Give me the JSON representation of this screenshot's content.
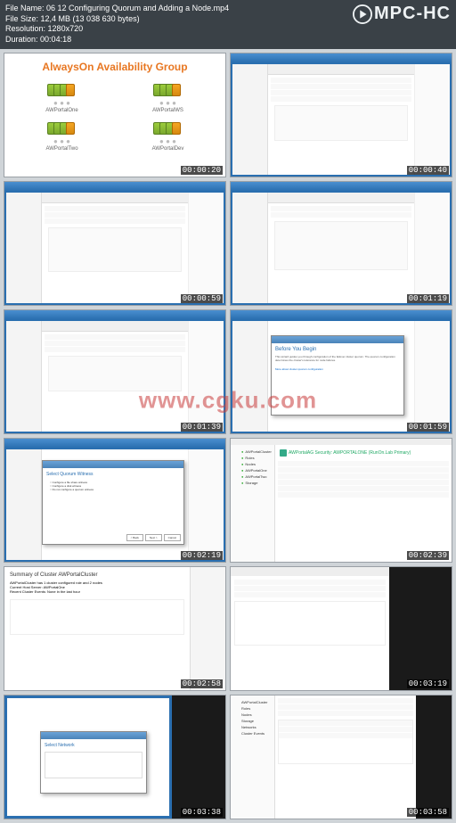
{
  "app": {
    "name": "MPC-HC"
  },
  "meta": {
    "filename_label": "File Name:",
    "filename": "06 12 Configuring Quorum and Adding a Node.mp4",
    "filesize_label": "File Size:",
    "filesize": "12,4 MB (13 038 630 bytes)",
    "resolution_label": "Resolution:",
    "resolution": "1280x720",
    "duration_label": "Duration:",
    "duration": "00:04:18"
  },
  "watermark": "www.cgku.com",
  "thumbs": [
    {
      "ts": "00:00:20",
      "kind": "diagram",
      "title": "AlwaysOn Availability Group",
      "nodes": [
        "AWPortalOne",
        "AWPortalWS",
        "AWPortalTwo",
        "AWPortalDev"
      ]
    },
    {
      "ts": "00:00:40",
      "kind": "mgr"
    },
    {
      "ts": "00:00:59",
      "kind": "mgr"
    },
    {
      "ts": "00:01:19",
      "kind": "mgr"
    },
    {
      "ts": "00:01:39",
      "kind": "mgr"
    },
    {
      "ts": "00:01:59",
      "kind": "wizard",
      "title": "Before You Begin"
    },
    {
      "ts": "00:02:19",
      "kind": "wizard2",
      "title": "Select Quorum Witness"
    },
    {
      "ts": "00:02:39",
      "kind": "security",
      "title": "AWPortalAG Security: AWPORTALONE (RunOn.Lab Primary)"
    },
    {
      "ts": "00:02:58",
      "kind": "summary",
      "title": "Summary of Cluster AWPortalCluster"
    },
    {
      "ts": "00:03:19",
      "kind": "dark"
    },
    {
      "ts": "00:03:38",
      "kind": "netdialog",
      "title": "Select Network"
    },
    {
      "ts": "00:03:58",
      "kind": "tree"
    }
  ],
  "wizard": {
    "next": "Next >",
    "back": "< Back",
    "cancel": "Cancel",
    "text": "This wizard guides you through configuration of the failover cluster quorum. The quorum configuration determines the cluster's tolerance for node failures.",
    "link": "More about cluster quorum configuration"
  },
  "quorum_opts": [
    "Configure a file share witness",
    "Configure a disk witness",
    "Do not configure a quorum witness"
  ],
  "summary": {
    "l1": "AWPortalCluster has 1 cluster configured role and 2 nodes",
    "l2": "Current Host Server: AWPortalOne",
    "l3": "Recent Cluster Events: None in the last hour"
  },
  "tree_items": [
    "AWPortalCluster",
    "Roles",
    "Nodes",
    "AWPortalOne",
    "AWPortalTwo",
    "Storage",
    "Networks",
    "Cluster Events"
  ]
}
